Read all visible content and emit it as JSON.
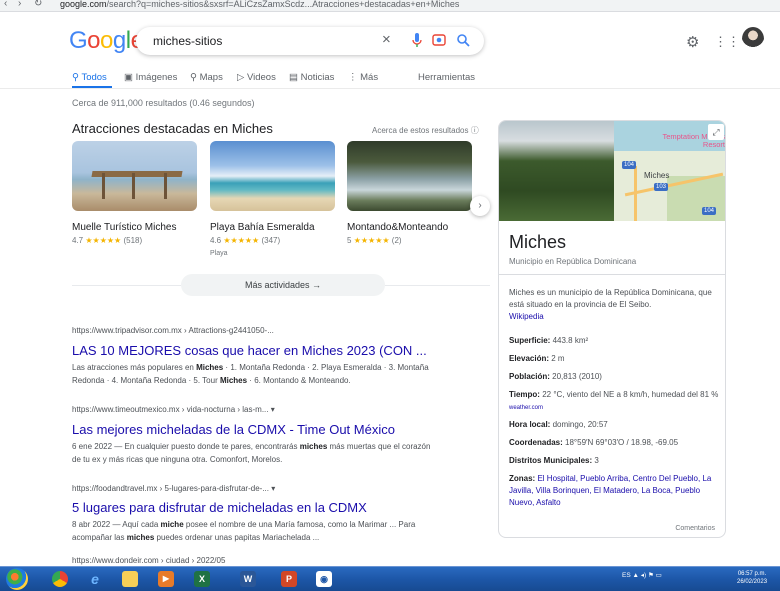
{
  "browser": {
    "url_domain": "google.com",
    "url_rest": "/search?q=miches-sitios&sxsrf=ALiCzsZamxScdz...Atracciones+destacadas+en+Miches"
  },
  "google_logo": [
    "G",
    "o",
    "o",
    "g",
    "l",
    "e"
  ],
  "search": {
    "query": "miches-sitios",
    "clear_icon": "close-icon",
    "mic_icon": "microphone-icon",
    "lens_icon": "camera-lens-icon",
    "search_icon": "search-icon"
  },
  "header_icons": [
    "gear-icon",
    "apps-grid-icon"
  ],
  "tabs": [
    {
      "label": "Todos",
      "icon": "search-icon"
    },
    {
      "label": "Imágenes",
      "icon": "image-icon"
    },
    {
      "label": "Maps",
      "icon": "map-pin-icon"
    },
    {
      "label": "Videos",
      "icon": "play-icon"
    },
    {
      "label": "Noticias",
      "icon": "newspaper-icon"
    },
    {
      "label": "Más",
      "icon": "more-vert-icon"
    }
  ],
  "tools_label": "Herramientas",
  "result_stats": "Cerca de 911,000 resultados (0.46 segundos)",
  "attractions": {
    "title": "Atracciones destacadas en Miches",
    "info": "Acerca de estos resultados ⓘ",
    "items": [
      {
        "name": "Muelle Turístico Miches",
        "rating": "4.7",
        "stars": "★★★★★",
        "reviews": "(518)",
        "type": ""
      },
      {
        "name": "Playa Bahía Esmeralda",
        "rating": "4.6",
        "stars": "★★★★★",
        "reviews": "(347)",
        "type": "Playa"
      },
      {
        "name": "Montando&Monteando",
        "rating": "5",
        "stars": "★★★★★",
        "reviews": "(2)",
        "type": ""
      }
    ],
    "more_label": "Más actividades →"
  },
  "results": [
    {
      "url": "https://www.tripadvisor.com.mx › Attractions-g2441050-...",
      "title": "LAS 10 MEJORES cosas que hacer en Miches 2023 (CON ...",
      "snippet_parts": [
        "Las atracciones más populares en ",
        "Miches",
        " · 1. Montaña Redonda · 2. Playa Esmeralda · 3. Montaña Redonda · 4. Montaña Redonda · 5. Tour ",
        "Miches",
        " · 6. Montando & Monteando."
      ]
    },
    {
      "url": "https://www.timeoutmexico.mx › vida-nocturna › las-m... ▾",
      "title": "Las mejores micheladas de la CDMX - Time Out México",
      "snippet_parts": [
        "6 ene 2022 — En cualquier puesto donde te pares, encontrarás ",
        "miches",
        " más muertas que el corazón de tu ex y más ricas que ninguna otra. Comonfort, Morelos.",
        "",
        ""
      ]
    },
    {
      "url": "https://foodandtravel.mx › 5-lugares-para-disfrutar-de-... ▾",
      "title": "5 lugares para disfrutar de micheladas en la CDMX",
      "snippet_parts": [
        "8 abr 2022 — Aquí cada ",
        "miche",
        " posee el nombre de una María famosa, como la Marimar ... Para acompañar las ",
        "miches",
        " puedes ordenar unas papitas Mariachelada ..."
      ]
    }
  ],
  "next_result_url": "https://www.dondeir.com › ciudad › 2022/05",
  "knowledge_panel": {
    "map_resort": "Temptation Miches Resort",
    "map_town": "Miches",
    "map_shields": [
      "104",
      "103",
      "104"
    ],
    "title": "Miches",
    "subtitle": "Municipio en República Dominicana",
    "description": "Miches es un municipio de la República Dominicana, que está situado en la provincia de El Seibo.",
    "wiki_label": "Wikipedia",
    "facts": [
      {
        "label": "Superficie:",
        "value": "443.8 km²"
      },
      {
        "label": "Elevación:",
        "value": "2 m"
      },
      {
        "label": "Población:",
        "value": "20,813 (2010)"
      },
      {
        "label": "Tiempo:",
        "value": "22 °C, viento del NE a 8 km/h, humedad del 81 %",
        "source": "weather.com"
      },
      {
        "label": "Hora local:",
        "value": "domingo, 20:57"
      },
      {
        "label": "Coordenadas:",
        "value": "18°59′N 69°03′O / 18.98, -69.05"
      },
      {
        "label": "Distritos Municipales:",
        "value": "3"
      },
      {
        "label": "Zonas:",
        "value": "El Hospital, Pueblo Arriba, Centro Del Pueblo, La Javilla, Villa Borinquen, El Matadero, La Boca, Pueblo Nuevo, Asfalto"
      }
    ],
    "comments_label": "Comentarios"
  },
  "taskbar": {
    "apps": [
      "start-orb",
      "chrome",
      "ie",
      "explorer",
      "media",
      "excel",
      "word",
      "powerpoint",
      "camera"
    ],
    "app_letters": {
      "excel": "X",
      "word": "W",
      "powerpoint": "P"
    },
    "language": "ES",
    "time": "06:57 p.m.",
    "date": "26/02/2023"
  },
  "colors": {
    "link": "#1a0dab",
    "accent": "#1a73e8",
    "star": "#f4b400",
    "taskbar": "#1d57a8"
  }
}
